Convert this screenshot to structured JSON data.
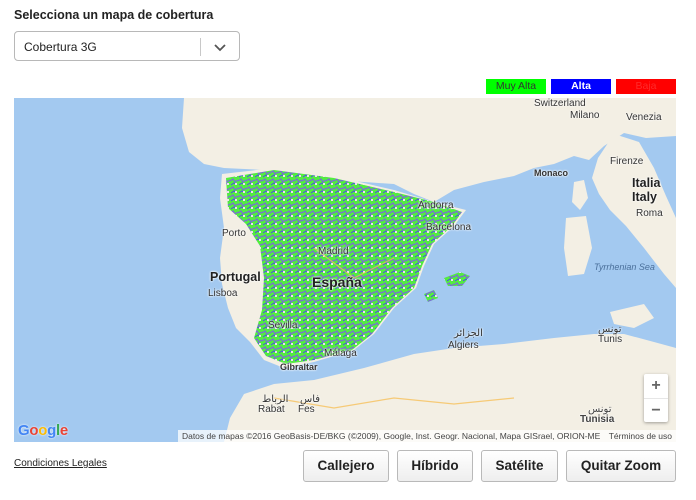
{
  "heading": "Selecciona un mapa de cobertura",
  "coverage_select": {
    "value": "Cobertura 3G"
  },
  "legend": [
    {
      "label": "Muy Alta",
      "color": "#00ff00"
    },
    {
      "label": "Alta",
      "color": "#0000ff"
    },
    {
      "label": "Baja",
      "color": "#ff0000"
    }
  ],
  "map": {
    "labels": {
      "switzerland": "Switzerland",
      "milano": "Milano",
      "venezia": "Venezia",
      "firenze": "Firenze",
      "italia": "Italia",
      "italy": "Italy",
      "roma": "Roma",
      "monaco": "Monaco",
      "andorra": "Andorra",
      "barcelona": "Barcelona",
      "porto": "Porto",
      "madrid": "Madrid",
      "portugal": "Portugal",
      "lisboa": "Lisboa",
      "espana": "España",
      "tyrrhenian_sea": "Tyrrhenian Sea",
      "tunis_ar": "تونس",
      "tunis": "Tunis",
      "algiers_ar": "الجزائر",
      "algiers": "Algiers",
      "sevilla": "Sevilla",
      "malaga": "Málaga",
      "gibraltar": "Gibraltar",
      "rabat_ar": "الرباط",
      "rabat": "Rabat",
      "fes_ar": "فاس",
      "fes": "Fes",
      "tunisia_ar": "تونس",
      "tunisia": "Tunisia"
    },
    "attribution": "Datos de mapas ©2016 GeoBasis-DE/BKG (©2009), Google, Inst. Geogr. Nacional, Mapa GISrael, ORION-ME",
    "terms": "Términos de uso",
    "zoom_in": "+",
    "zoom_out": "−",
    "google_logo": [
      "G",
      "o",
      "o",
      "g",
      "l",
      "e"
    ]
  },
  "legal_link": "Condiciones Legales",
  "buttons": {
    "callejero": "Callejero",
    "hibrido": "Híbrido",
    "satelite": "Satélite",
    "quitar_zoom": "Quitar Zoom"
  },
  "colors": {
    "sea": "#a3c9f0",
    "land": "#f3efe4",
    "coverage_green": "#52ee3e",
    "coverage_purple": "#7a6bd6",
    "coverage_blue": "#4a4ae8"
  }
}
